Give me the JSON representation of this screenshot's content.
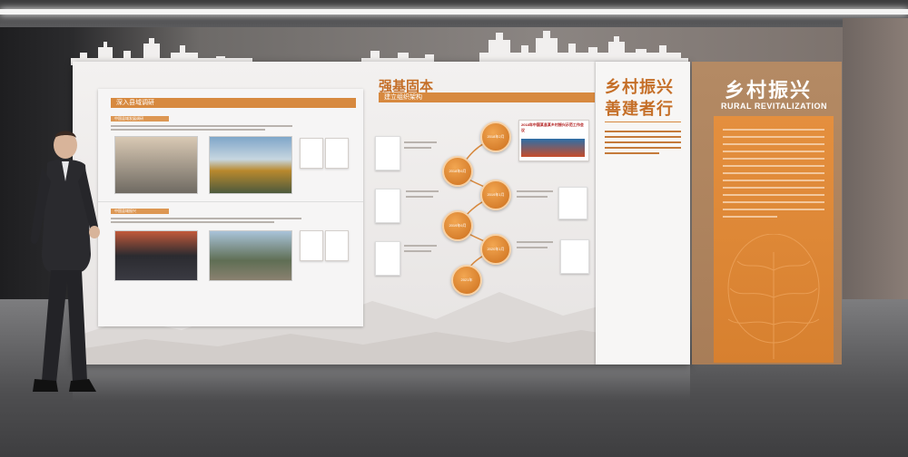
{
  "left_panel": {
    "header": "深入县域调研",
    "sub1": "中国县域发展调研",
    "sub2": "中国县域振兴"
  },
  "middle_panel": {
    "title": "强基固本",
    "subtitle": "建立组织架构",
    "poster_caption": "2018年中国某县某乡村振兴示范工作会议",
    "timeline": [
      "2018年2月",
      "2018年6月",
      "2019年1月",
      "2019年6月",
      "2020年1月",
      "2021年"
    ]
  },
  "slogan_column": {
    "line1": "乡村振兴",
    "line2": "善建者行"
  },
  "right_column": {
    "title_cn": "乡村振兴",
    "title_en": "RURAL REVITALIZATION"
  },
  "colors": {
    "accent": "#d7893f",
    "title": "#c56f28",
    "orange_block": "#e48f3e"
  }
}
